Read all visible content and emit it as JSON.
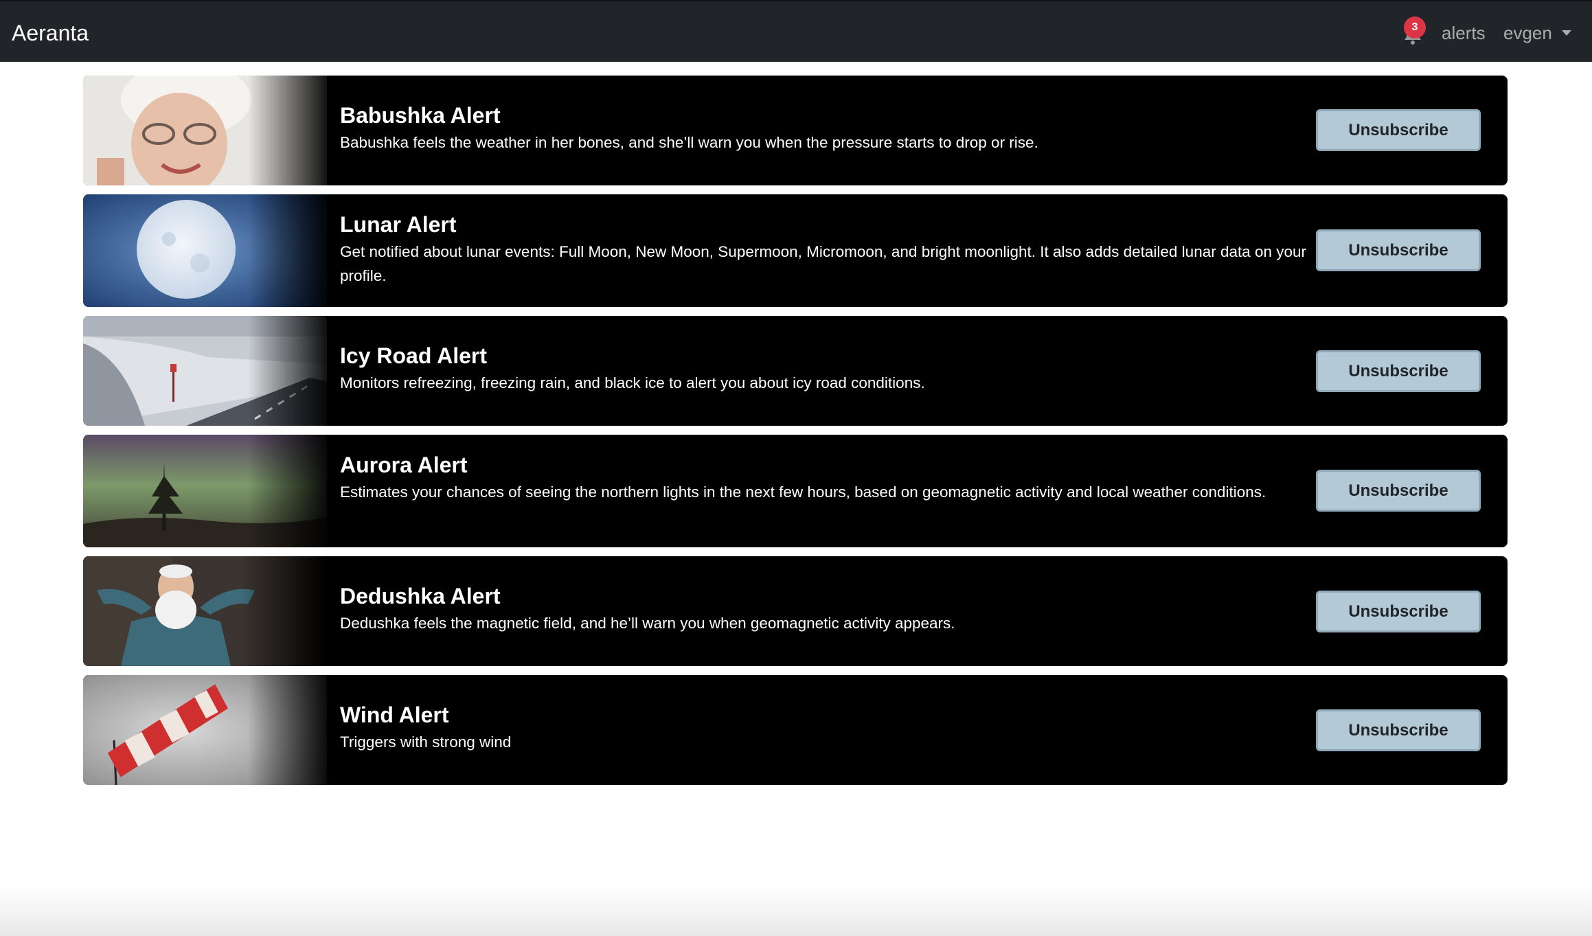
{
  "navbar": {
    "brand": "Aeranta",
    "notification_count": "3",
    "alerts_link": "alerts",
    "user_name": "evgen"
  },
  "alerts": [
    {
      "title": "Babushka Alert",
      "description": "Babushka feels the weather in her bones, and she’ll warn you when the pressure starts to drop or rise.",
      "button": "Unsubscribe",
      "image": "grandmother-photo"
    },
    {
      "title": "Lunar Alert",
      "description": "Get notified about lunar events: Full Moon, New Moon, Supermoon, Micromoon, and bright moonlight. It also adds detailed lunar data on your profile.",
      "button": "Unsubscribe",
      "image": "full-moon-photo"
    },
    {
      "title": "Icy Road Alert",
      "description": "Monitors refreezing, freezing rain, and black ice to alert you about icy road conditions.",
      "button": "Unsubscribe",
      "image": "icy-road-photo"
    },
    {
      "title": "Aurora Alert",
      "description": "Estimates your chances of seeing the northern lights in the next few hours, based on geomagnetic activity and local weather conditions.",
      "button": "Unsubscribe",
      "image": "aurora-photo"
    },
    {
      "title": "Dedushka Alert",
      "description": "Dedushka feels the magnetic field, and he’ll warn you when geomagnetic activity appears.",
      "button": "Unsubscribe",
      "image": "grandfather-photo"
    },
    {
      "title": "Wind Alert",
      "description": "Triggers with strong wind",
      "button": "Unsubscribe",
      "image": "windsock-photo"
    }
  ]
}
